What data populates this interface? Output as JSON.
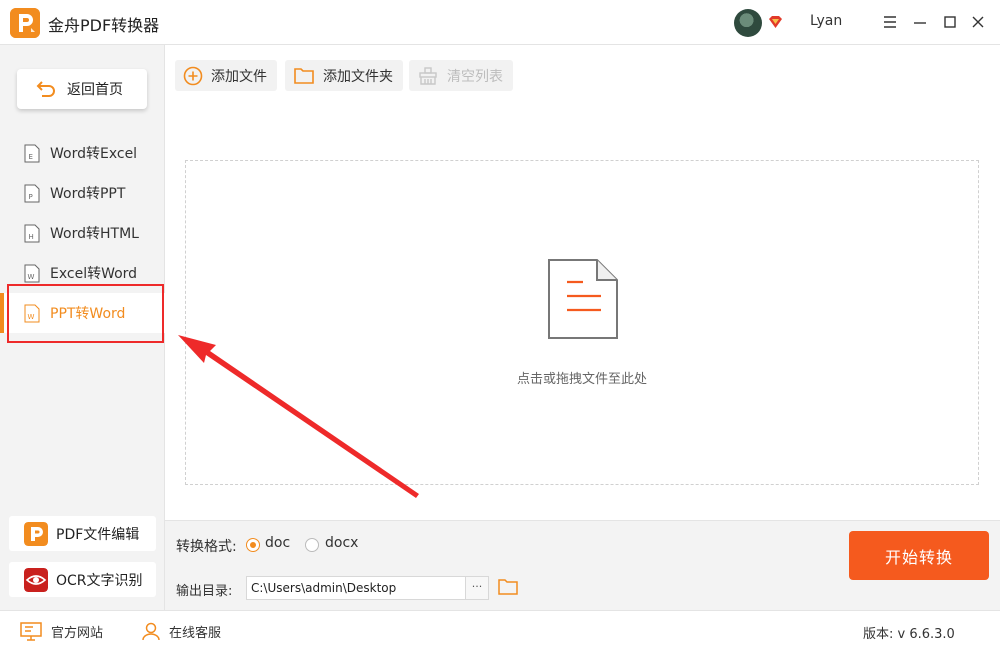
{
  "app": {
    "title": "金舟PDF转换器",
    "accent_color": "#f28c1f",
    "start_color": "#f55a1e"
  },
  "user": {
    "name": "Lyan"
  },
  "sidebar": {
    "back_label": "返回首页",
    "items": [
      {
        "label": "Word转Excel",
        "icon_letter": "E"
      },
      {
        "label": "Word转PPT",
        "icon_letter": "P"
      },
      {
        "label": "Word转HTML",
        "icon_letter": "H"
      },
      {
        "label": "Excel转Word",
        "icon_letter": "W"
      },
      {
        "label": "PPT转Word",
        "icon_letter": "W",
        "active": true
      }
    ],
    "tools": [
      {
        "label": "PDF文件编辑"
      },
      {
        "label": "OCR文字识别"
      }
    ]
  },
  "toolbar": {
    "add_file": "添加文件",
    "add_folder": "添加文件夹",
    "clear_list": "清空列表"
  },
  "drop_area": {
    "hint": "点击或拖拽文件至此处"
  },
  "settings": {
    "format_label": "转换格式:",
    "formats": [
      "doc",
      "docx"
    ],
    "selected_format": "doc",
    "output_label": "输出目录:",
    "output_path": "C:\\Users\\admin\\Desktop",
    "browse_label": "···",
    "start_label": "开始转换"
  },
  "footer": {
    "website": "官方网站",
    "support": "在线客服",
    "version": "版本: v 6.6.3.0"
  }
}
